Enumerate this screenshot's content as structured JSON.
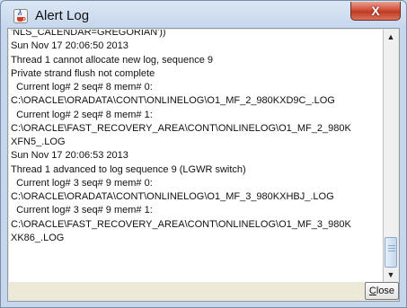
{
  "window": {
    "title": "Alert Log",
    "close_glyph": "X",
    "icon": "java-cup-icon"
  },
  "log": {
    "lines": [
      "'NLS_CALENDAR=GREGORIAN'))",
      "Sun Nov 17 20:06:50 2013",
      "Thread 1 cannot allocate new log, sequence 9",
      "Private strand flush not complete",
      "  Current log# 2 seq# 8 mem# 0:",
      "C:\\ORACLE\\ORADATA\\CONT\\ONLINELOG\\O1_MF_2_980KXD9C_.LOG",
      "  Current log# 2 seq# 8 mem# 1:",
      "C:\\ORACLE\\FAST_RECOVERY_AREA\\CONT\\ONLINELOG\\O1_MF_2_980K",
      "XFN5_.LOG",
      "Sun Nov 17 20:06:53 2013",
      "Thread 1 advanced to log sequence 9 (LGWR switch)",
      "  Current log# 3 seq# 9 mem# 0:",
      "C:\\ORACLE\\ORADATA\\CONT\\ONLINELOG\\O1_MF_3_980KXHBJ_.LOG",
      "  Current log# 3 seq# 9 mem# 1:",
      "C:\\ORACLE\\FAST_RECOVERY_AREA\\CONT\\ONLINELOG\\O1_MF_3_980K",
      "XK86_.LOG"
    ]
  },
  "scrollbar": {
    "up_glyph": "▲",
    "down_glyph": "▼",
    "position_fraction": 1.0
  },
  "footer": {
    "close_mnemonic": "C",
    "close_rest": "lose"
  }
}
